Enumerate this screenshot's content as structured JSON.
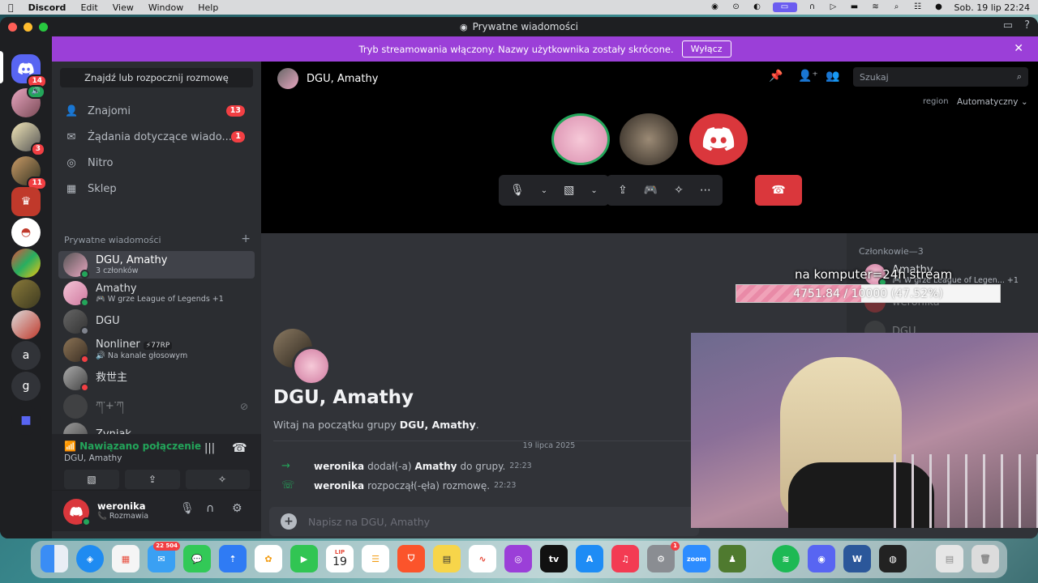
{
  "menubar": {
    "app_name": "Discord",
    "items": [
      "Edit",
      "View",
      "Window",
      "Help"
    ],
    "clock": "Sob. 19 lip  22:24"
  },
  "window": {
    "title": "Prywatne wiadomości"
  },
  "banner": {
    "text": "Tryb streamowania włączony. Nazwy użytkownika zostały skrócone.",
    "button": "Wyłącz"
  },
  "servers": {
    "home_badge": "14",
    "badge_2": "3",
    "badge_3": "11",
    "letter_a": "a",
    "letter_g": "g"
  },
  "sidebar": {
    "find_button": "Znajdź lub rozpocznij rozmowę",
    "nav": [
      {
        "label": "Znajomi",
        "count": "13",
        "icon": "friends-icon"
      },
      {
        "label": "Żądania dotyczące wiado...",
        "count": "1",
        "icon": "envelope-icon"
      },
      {
        "label": "Nitro",
        "count": "",
        "icon": "nitro-icon"
      },
      {
        "label": "Sklep",
        "count": "",
        "icon": "shop-icon"
      }
    ],
    "dm_header": "Prywatne wiadomości",
    "dms": [
      {
        "name": "DGU, Amathy",
        "sub": "3 członków"
      },
      {
        "name": "Amathy",
        "sub": "🎮 W grze League of Legends +1"
      },
      {
        "name": "DGU",
        "sub": ""
      },
      {
        "name": "Nonliner",
        "tag": "⚡77RP",
        "sub": "🔊 Na kanale głosowym"
      },
      {
        "name": "救世主",
        "sub": ""
      },
      {
        "name": "ཀ་+་ཀ",
        "sub": ""
      },
      {
        "name": "Zyniak",
        "sub": ""
      }
    ]
  },
  "voice": {
    "status": "Nawiązano połączenie",
    "channel": "DGU, Amathy"
  },
  "user": {
    "name": "weronika",
    "status": "📞 Rozmawia"
  },
  "header": {
    "title": "DGU, Amathy",
    "search_placeholder": "Szukaj",
    "region_label": "region",
    "region_value": "Automatyczny ⌄"
  },
  "chat": {
    "group_title": "DGU, Amathy",
    "welcome_prefix": "Witaj na początku grupy ",
    "welcome_name": "DGU, Amathy",
    "welcome_suffix": ".",
    "date": "19 lipca 2025",
    "messages": [
      {
        "user": "weronika",
        "text": "dodał(-a)",
        "target": "Amathy",
        "rest": "do grupy.",
        "time": "22:23"
      },
      {
        "user": "weronika",
        "text": "rozpoczął(-ęła) rozmowę.",
        "target": "",
        "rest": "",
        "time": "22:23"
      }
    ],
    "composer_placeholder": "Napisz na DGU, Amathy"
  },
  "members": {
    "header": "Członkowie—3",
    "list": [
      {
        "name": "Amathy",
        "sub": "🎮 W grze League of Legen... +1"
      },
      {
        "name": "weronika",
        "sub": ""
      },
      {
        "name": "DGU",
        "sub": ""
      }
    ]
  },
  "overlay": {
    "title": "na komputer=24h stream",
    "progress_text": "4751.84 / 10000 (47.52%)",
    "progress_fraction": 0.4752
  },
  "dock": {
    "mail_badge": "22 504",
    "calendar_month": "LIP",
    "calendar_day": "19",
    "settings_badge": "1",
    "zoom_label": "zoom"
  },
  "colors": {
    "accent": "#5865f2",
    "banner": "#9b3fd8",
    "online": "#23a55a",
    "danger": "#da373c"
  }
}
